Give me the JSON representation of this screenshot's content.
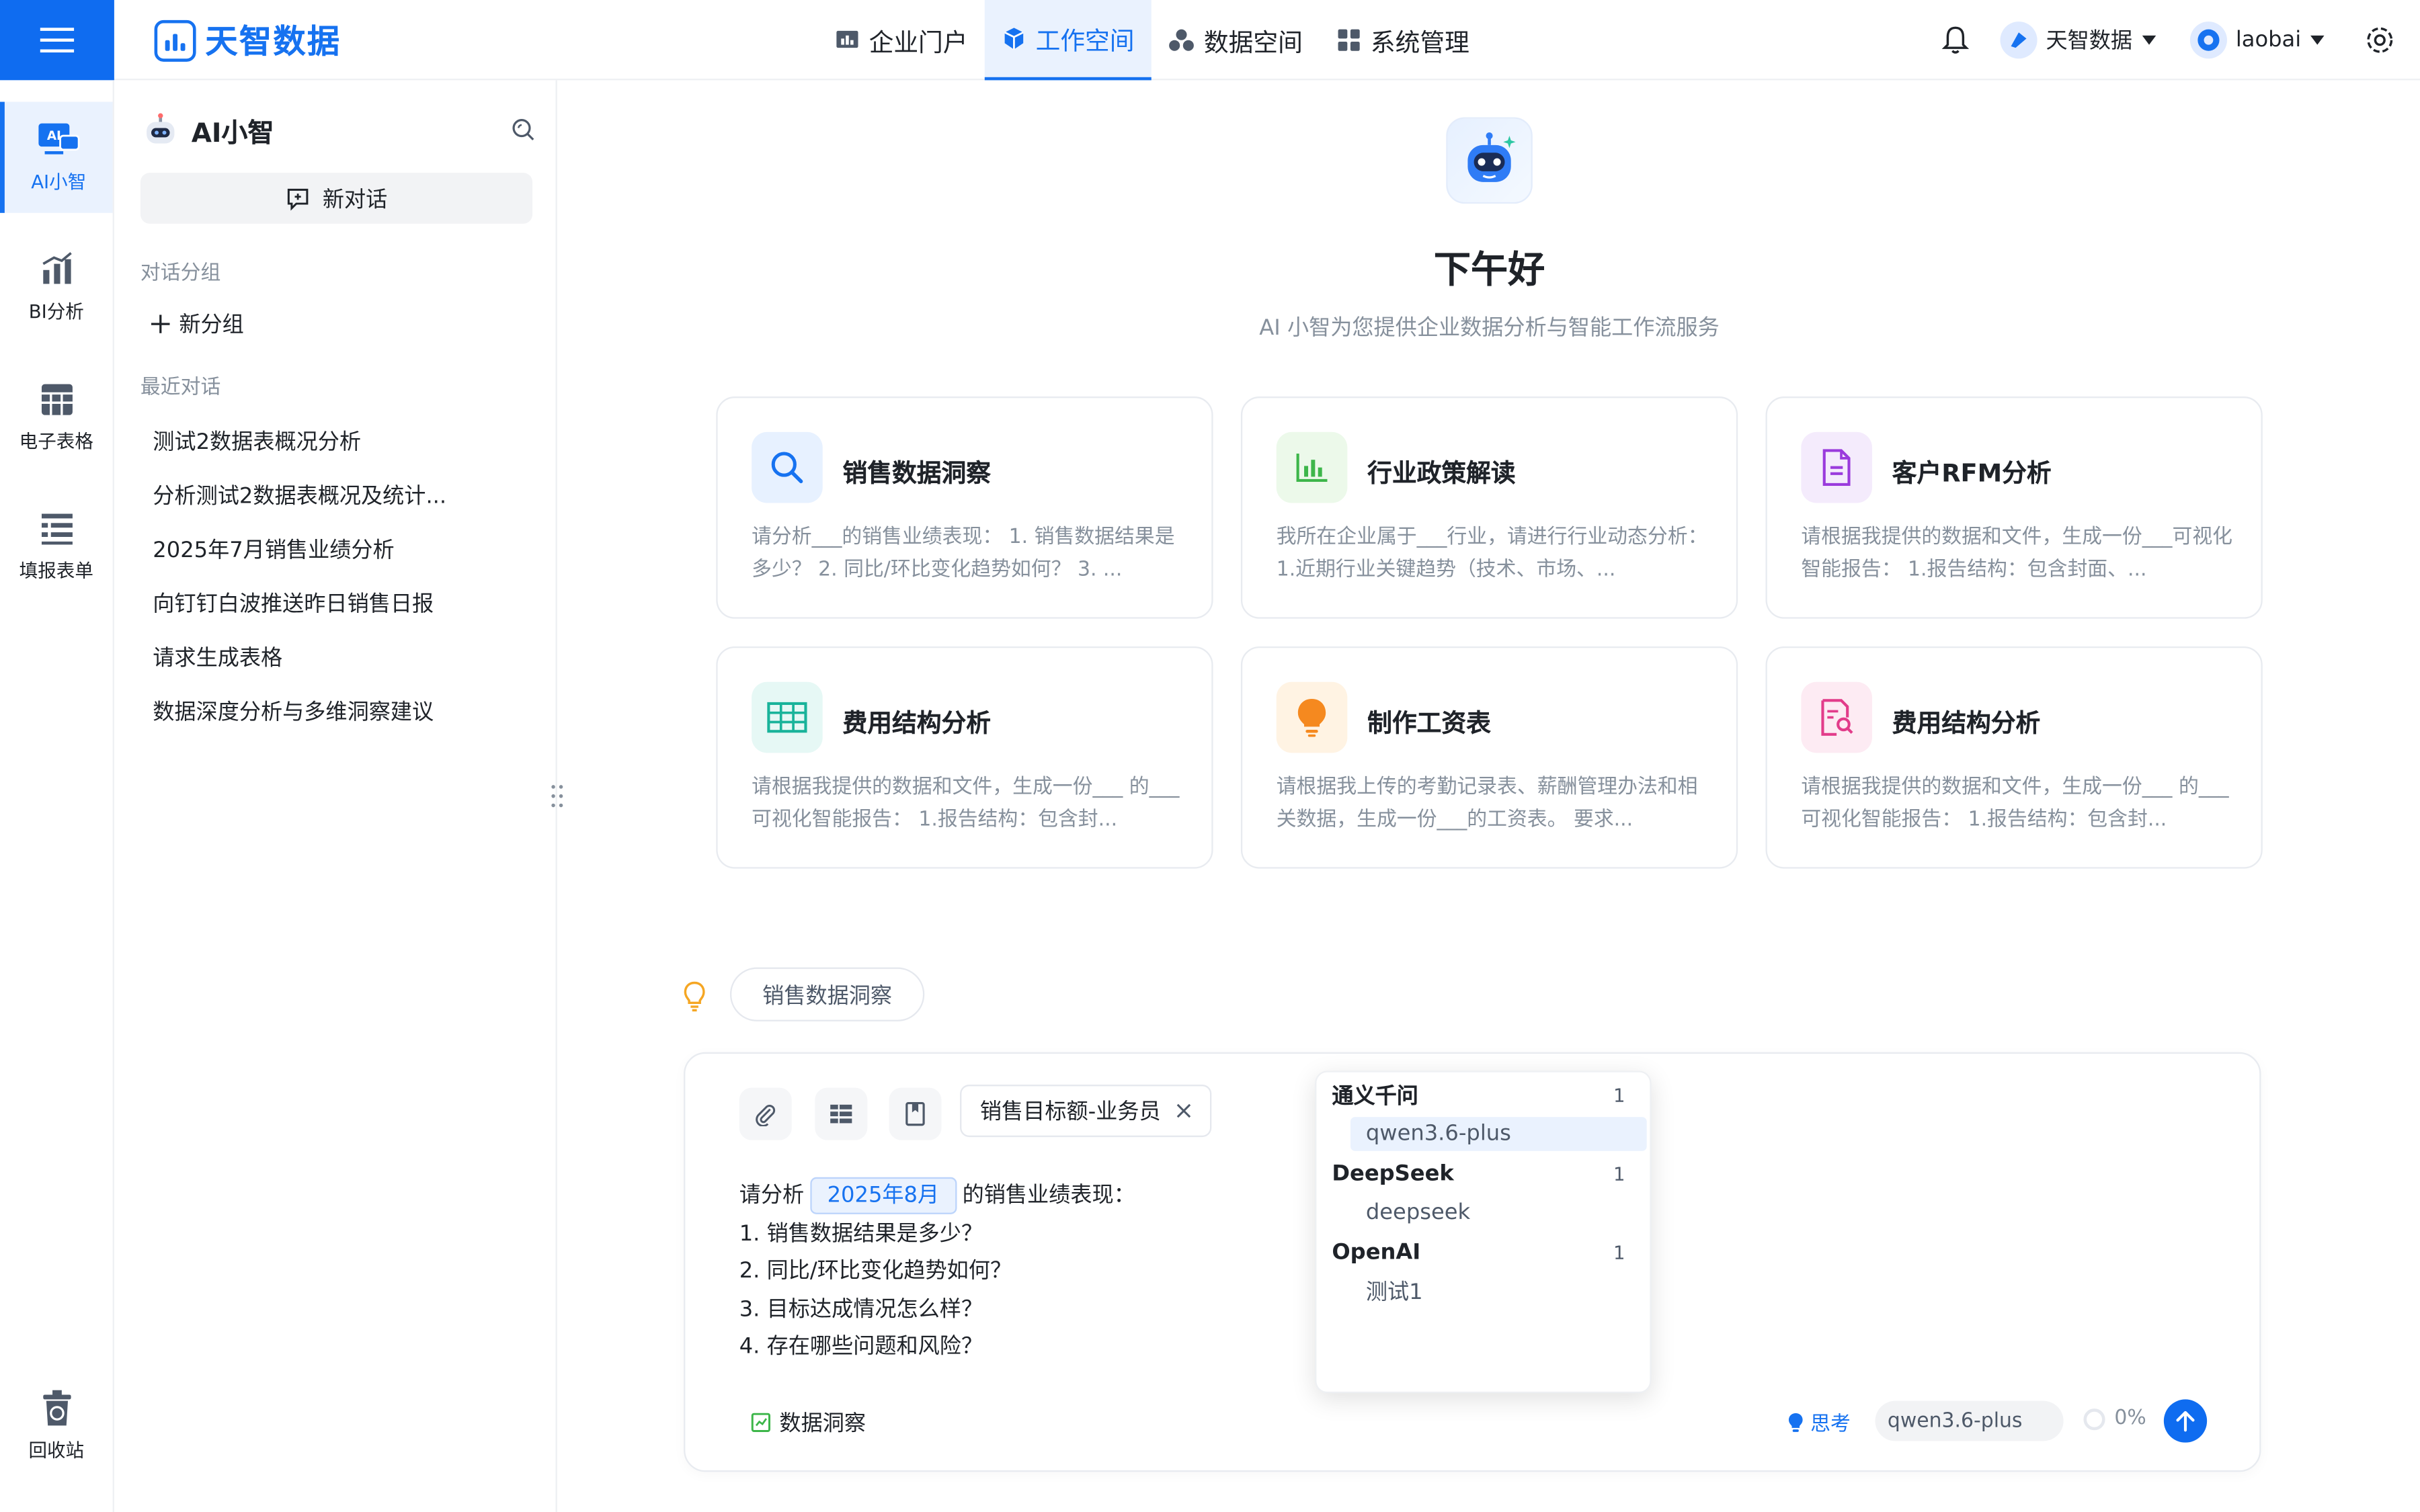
{
  "header": {
    "logo_text": "天智数据",
    "nav": [
      {
        "label": "企业门户"
      },
      {
        "label": "工作空间"
      },
      {
        "label": "数据空间"
      },
      {
        "label": "系统管理"
      }
    ],
    "org_label": "天智数据",
    "user_label": "laobai"
  },
  "rail": {
    "items": [
      {
        "label": "AI小智",
        "icon_text": "AI"
      },
      {
        "label": "BI分析"
      },
      {
        "label": "电子表格"
      },
      {
        "label": "填报表单"
      }
    ],
    "recycle_label": "回收站"
  },
  "panel": {
    "title": "AI小智",
    "new_chat_label": "新对话",
    "groups_label": "对话分组",
    "new_group_label": "新分组",
    "recent_label": "最近对话",
    "conversations": [
      "测试2数据表概况分析",
      "分析测试2数据表概况及统计...",
      "2025年7月销售业绩分析",
      "向钉钉白波推送昨日销售日报",
      "请求生成表格",
      "数据深度分析与多维洞察建议"
    ]
  },
  "main": {
    "greeting": "下午好",
    "subtitle": "AI 小智为您提供企业数据分析与智能工作流服务",
    "cards": [
      {
        "title": "销售数据洞察",
        "desc": "请分析___的销售业绩表现： 1. 销售数据结果是多少？ 2. 同比/环比变化趋势如何？ 3. ..."
      },
      {
        "title": "行业政策解读",
        "desc": "我所在企业属于___行业，请进行行业动态分析： 1.近期行业关键趋势（技术、市场、..."
      },
      {
        "title": "客户RFM分析",
        "desc": "请根据我提供的数据和文件，生成一份___可视化智能报告： 1.报告结构：包含封面、..."
      },
      {
        "title": "费用结构分析",
        "desc": "请根据我提供的数据和文件，生成一份___ 的___可视化智能报告： 1.报告结构：包含封..."
      },
      {
        "title": "制作工资表",
        "desc": "请根据我上传的考勤记录表、薪酬管理办法和相关数据，生成一份___的工资表。 要求..."
      },
      {
        "title": "费用结构分析",
        "desc": "请根据我提供的数据和文件，生成一份___ 的___可视化智能报告： 1.报告结构：包含封..."
      }
    ],
    "tip_chip": "销售数据洞察"
  },
  "composer": {
    "file_chip": "销售目标额-业务员",
    "prompt_prefix": "请分析",
    "prompt_slot": "2025年8月",
    "prompt_suffix": "的销售业绩表现：",
    "prompt_lines": [
      "1. 销售数据结果是多少？",
      "2. 同比/环比变化趋势如何？",
      "3. 目标达成情况怎么样？",
      "4. 存在哪些问题和风险？"
    ],
    "mode_label": "数据洞察",
    "think_label": "思考",
    "model_value": "qwen3.6-plus",
    "progress_label": "0%"
  },
  "model_dropdown": {
    "groups": [
      {
        "name": "通义千问",
        "count": "1",
        "options": [
          "qwen3.6-plus"
        ]
      },
      {
        "name": "DeepSeek",
        "count": "1",
        "options": [
          "deepseek"
        ]
      },
      {
        "name": "OpenAI",
        "count": "1",
        "options": [
          "测试1"
        ]
      }
    ]
  },
  "colors": {
    "brand": "#0f6cf0",
    "active_bg": "#eaf2fe",
    "muted_text": "#86909c"
  }
}
